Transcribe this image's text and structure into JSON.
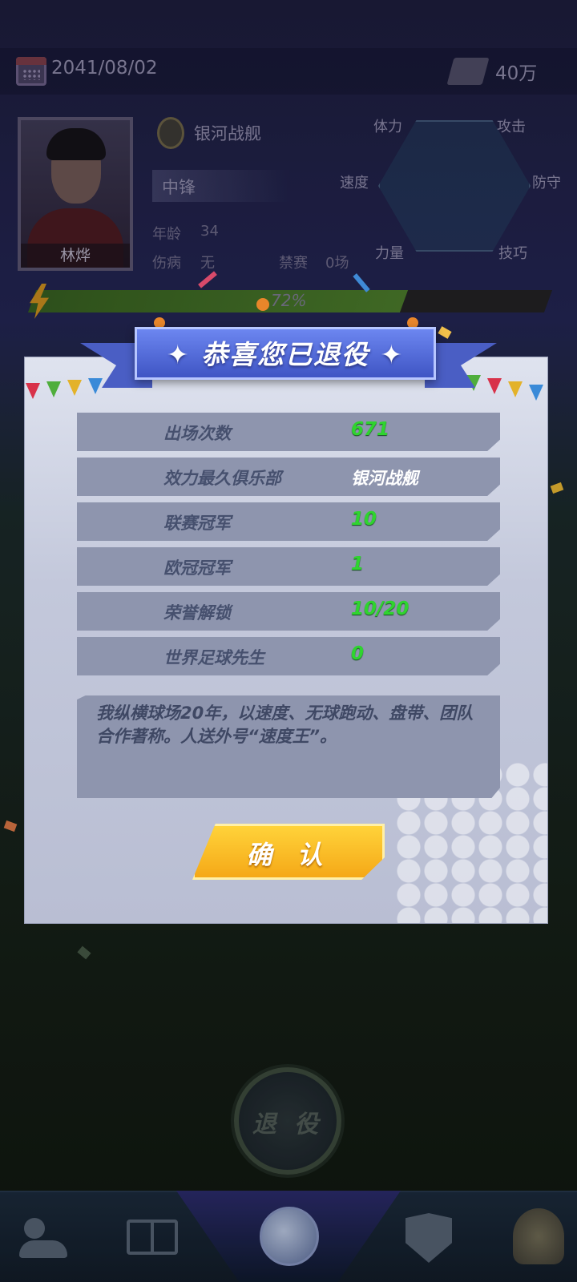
{
  "topbar": {
    "date": "2041/08/02",
    "money": "40万"
  },
  "player": {
    "name": "林烨",
    "club": "银河战舰",
    "position": "中锋",
    "age_label": "年龄",
    "age": "34",
    "injury_label": "伤病",
    "injury": "无",
    "ban_label": "禁赛",
    "ban": "0场",
    "xp_percent": "72%",
    "xp_fraction": 0.72
  },
  "radar": {
    "stamina": "体力",
    "attack": "攻击",
    "speed": "速度",
    "defense": "防守",
    "strength": "力量",
    "skill": "技巧"
  },
  "modal": {
    "title": "✦ 恭喜您已退役 ✦",
    "rows": [
      {
        "label": "出场次数",
        "value": "671"
      },
      {
        "label": "效力最久俱乐部",
        "value": "银河战舰"
      },
      {
        "label": "联赛冠军",
        "value": "10"
      },
      {
        "label": "欧冠冠军",
        "value": "1"
      },
      {
        "label": "荣誉解锁",
        "value": "10/20"
      },
      {
        "label": "世界足球先生",
        "value": "0"
      }
    ],
    "description": "我纵横球场20年，以速度、无球跑动、盘带、团队合作著称。人送外号“速度王”。",
    "confirm": "确 认"
  },
  "retire_button": "退 役",
  "colors": {
    "value_green": "#2fd42f",
    "banner_blue": "#4a5ec4",
    "confirm_yellow": "#f5a817"
  },
  "nav_icons": [
    "users-icon",
    "field-icon",
    "soccer-ball-icon",
    "shield-icon",
    "trophy-icon"
  ]
}
